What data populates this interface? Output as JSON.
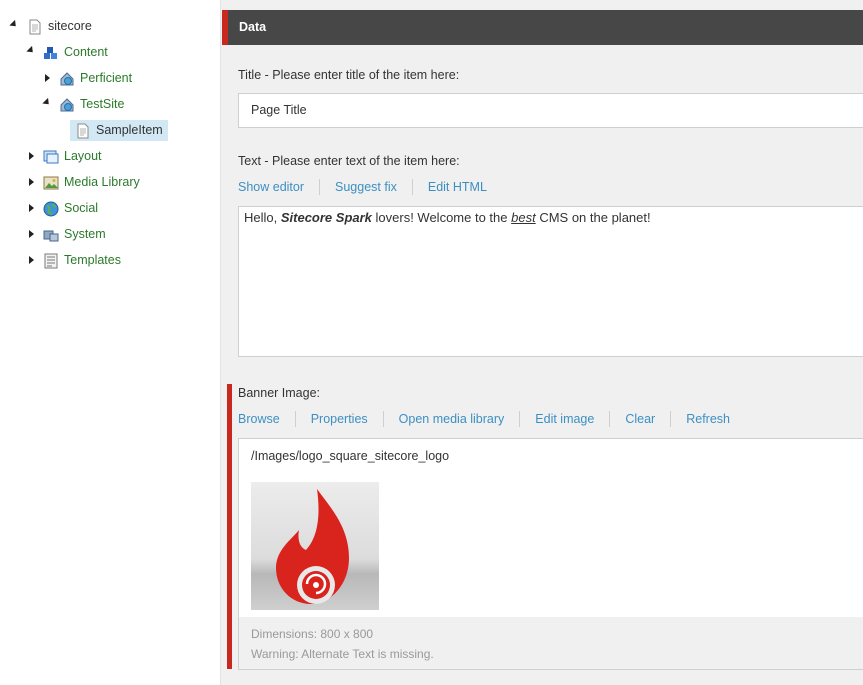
{
  "tree": {
    "root": {
      "label": "sitecore",
      "icon": "document-icon"
    },
    "content": {
      "label": "Content",
      "icon": "cubes-icon"
    },
    "perficient": {
      "label": "Perficient",
      "icon": "home-globe-icon"
    },
    "testsite": {
      "label": "TestSite",
      "icon": "home-globe-icon"
    },
    "sampleitem": {
      "label": "SampleItem",
      "icon": "document-icon"
    },
    "layout": {
      "label": "Layout",
      "icon": "layout-icon"
    },
    "media": {
      "label": "Media Library",
      "icon": "image-icon"
    },
    "social": {
      "label": "Social",
      "icon": "globe-icon"
    },
    "system": {
      "label": "System",
      "icon": "system-icon"
    },
    "templates": {
      "label": "Templates",
      "icon": "template-icon"
    }
  },
  "section": {
    "title": "Data",
    "accent": "#c8281e"
  },
  "fields": {
    "title": {
      "label": "Title - Please enter title of the item here:",
      "value": "Page Title"
    },
    "text": {
      "label": "Text - Please enter text of the item here:",
      "actions": [
        "Show editor",
        "Suggest fix",
        "Edit HTML"
      ],
      "content": {
        "t1": "Hello, ",
        "bold": "Sitecore Spark",
        "t2": " lovers! Welcome to the ",
        "emph": "best",
        "t3": " CMS on the planet!"
      }
    },
    "banner": {
      "label": "Banner Image:",
      "actions": [
        "Browse",
        "Properties",
        "Open media library",
        "Edit image",
        "Clear",
        "Refresh"
      ],
      "path": "/Images/logo_square_sitecore_logo",
      "dimensions": "Dimensions: 800 x 800",
      "warning": "Warning: Alternate Text is missing."
    }
  },
  "colors": {
    "link": "#3d8fc2",
    "tree_label": "#2b7a2b",
    "header_bg": "#474747",
    "selected_bg": "#d3e8f5"
  }
}
